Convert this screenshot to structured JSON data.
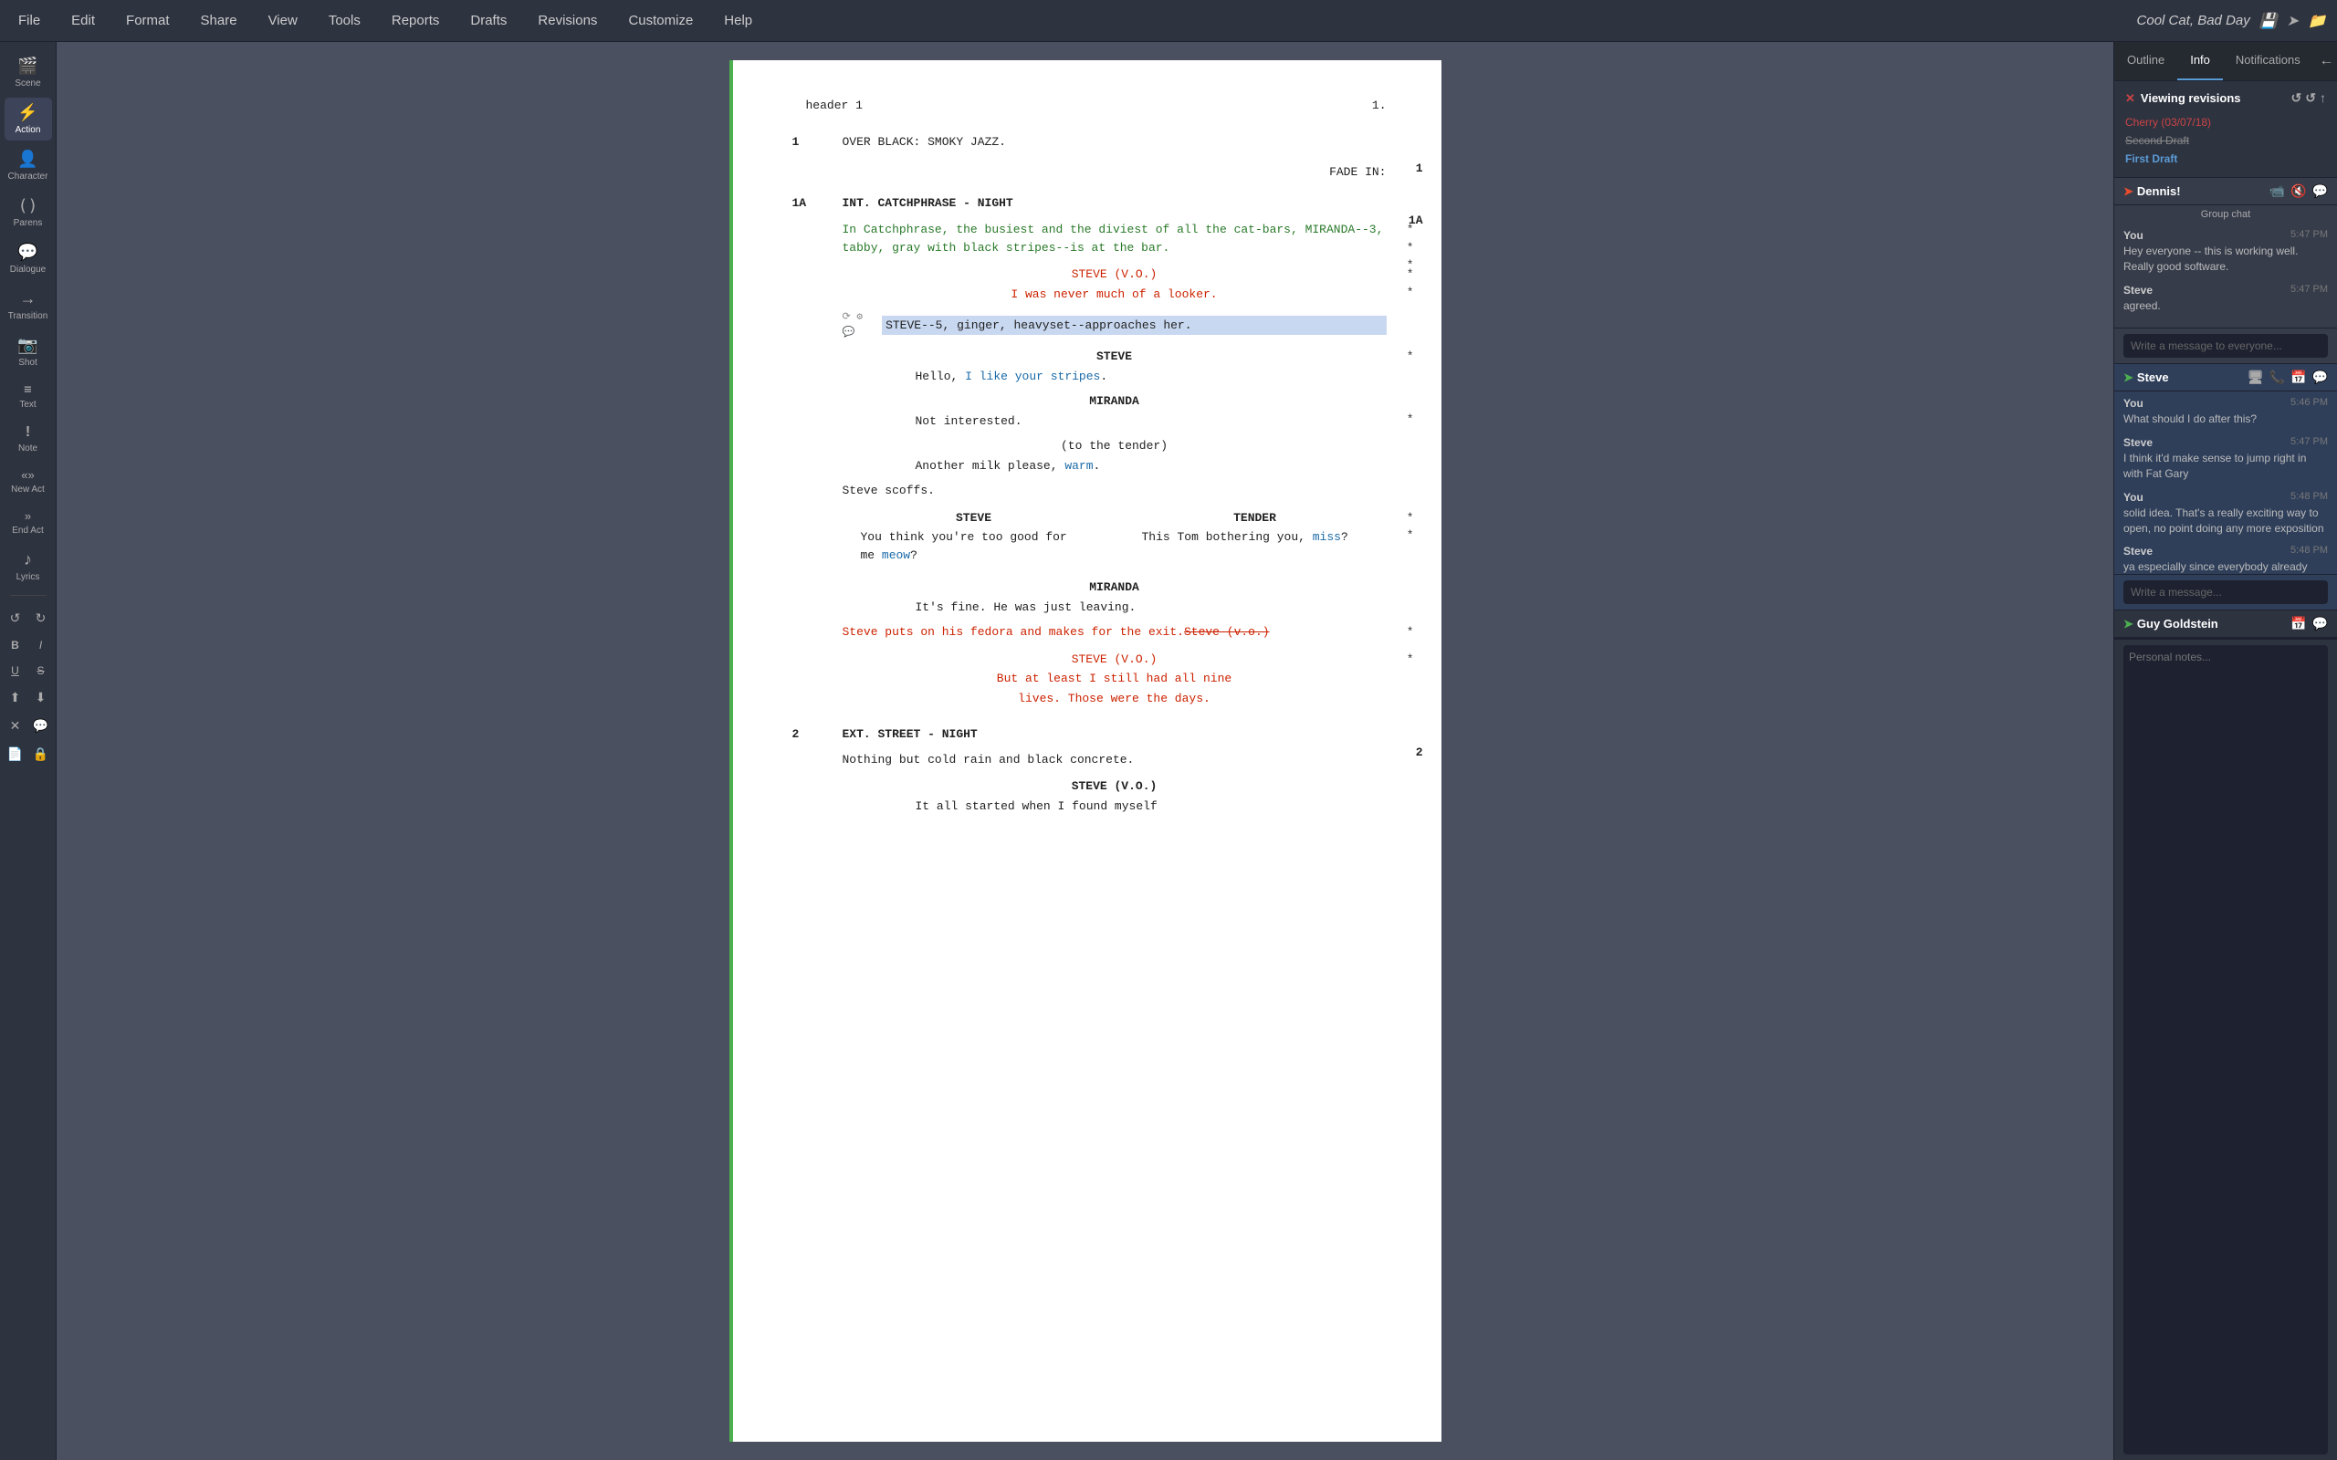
{
  "menu": {
    "items": [
      "File",
      "Edit",
      "Format",
      "Share",
      "View",
      "Tools",
      "Reports",
      "Drafts",
      "Revisions",
      "Customize",
      "Help"
    ]
  },
  "title": {
    "text": "Cool Cat, Bad Day",
    "icon_save": "💾",
    "icon_share": "➤",
    "icon_folder": "📁"
  },
  "sidebar": {
    "items": [
      {
        "icon": "🎬",
        "label": "Scene"
      },
      {
        "icon": "⚡",
        "label": "Action"
      },
      {
        "icon": "👤",
        "label": "Character"
      },
      {
        "icon": "()",
        "label": "Parens"
      },
      {
        "icon": "💬",
        "label": "Dialogue"
      },
      {
        "icon": "→",
        "label": "Transition"
      },
      {
        "icon": "📷",
        "label": "Shot"
      },
      {
        "icon": "≡",
        "label": "Text"
      },
      {
        "icon": "!",
        "label": "Note"
      },
      {
        "icon": "«»",
        "label": "New Act"
      },
      {
        "icon": "»",
        "label": "End Act"
      },
      {
        "icon": "♪",
        "label": "Lyrics"
      }
    ],
    "bottom_icons": [
      "↺",
      "↻",
      "B",
      "I",
      "U",
      "S",
      "⬆",
      "⬇",
      "✕",
      "💬",
      "📄",
      "🔒"
    ]
  },
  "script": {
    "header": {
      "left": "header 1",
      "right": "1."
    },
    "scene1": {
      "number": "1",
      "action": "OVER BLACK: SMOKY JAZZ.",
      "scene_number_right": "1"
    },
    "fade_in": "FADE IN:",
    "scene1a": {
      "number": "1A",
      "heading": "INT. CATCHPHRASE - NIGHT",
      "scene_number_right": "1A",
      "action_green": "In Catchphrase, the busiest and the diviest of all the cat-bars, MIRANDA--3, tabby, gray with black stripes--is at the bar.",
      "vo_char": "STEVE (V.O.)",
      "vo_line1": "I was never much of a looker.",
      "highlight_action": "STEVE--5, ginger, heavyset--approaches her.",
      "char1": "STEVE",
      "dia1": "Hello, I like your stripes.",
      "char2": "MIRANDA",
      "dia2a": "Not interested.",
      "paren2": "(to the tender)",
      "dia2b": "Another milk please, warm.",
      "action2": "Steve scoffs.",
      "dual_left": {
        "char": "STEVE",
        "dia": "You think you're too good for me meow?"
      },
      "dual_right": {
        "char": "TENDER",
        "dia": "This Tom bothering you, miss?"
      },
      "char3": "MIRANDA",
      "dia3": "It's fine. He was just leaving.",
      "red_action": "Steve puts on his fedora and makes for the exit.",
      "red_strike": "Steve (v.o.)",
      "vo_char2": "STEVE (V.O.)",
      "vo2_line1": "But at least I still had all nine",
      "vo2_line2": "lives. Those were the days."
    },
    "scene2": {
      "number": "2",
      "heading": "EXT. STREET - NIGHT",
      "scene_number_right": "2",
      "action3": "Nothing but cold rain and black concrete.",
      "char4": "STEVE (V.O.)",
      "dia4": "It all started when I found myself"
    }
  },
  "right_panel": {
    "tabs": [
      "Outline",
      "Info",
      "Notifications"
    ],
    "active_tab": "Info",
    "revisions_title": "Viewing revisions",
    "revision_items": [
      {
        "label": "Cherry (03/07/18)",
        "style": "cherry"
      },
      {
        "label": "Second Draft",
        "style": "second"
      },
      {
        "label": "First Draft",
        "style": "first"
      }
    ],
    "chats": [
      {
        "name": "Dennis!",
        "arrow_color": "red",
        "icons": [
          "📹",
          "🔇",
          "💬"
        ],
        "group_label": "Group chat",
        "messages": [
          {
            "sender": "You",
            "time": "5:47 PM",
            "text": "Hey everyone -- this is working well. Really good software."
          },
          {
            "sender": "Steve",
            "time": "5:47 PM",
            "text": "agreed."
          }
        ],
        "input_placeholder": "Write a message to everyone..."
      },
      {
        "name": "Steve",
        "arrow_color": "green",
        "icons": [
          "🖥",
          "📞",
          "📅",
          "💬"
        ],
        "messages": [
          {
            "sender": "You",
            "time": "5:46 PM",
            "text": "What should I do after this?"
          },
          {
            "sender": "Steve",
            "time": "5:47 PM",
            "text": "I think it'd make sense to jump right in with Fat Gary"
          },
          {
            "sender": "You",
            "time": "5:48 PM",
            "text": "solid idea. That's a really exciting way to open, no point doing any more exposition"
          },
          {
            "sender": "Steve",
            "time": "5:48 PM",
            "text": "ya especially since everybody already gets noir and knows what to expect right off the bat"
          }
        ],
        "input_placeholder": "Write a message..."
      },
      {
        "name": "Guy Goldstein",
        "arrow_color": "green",
        "icons": [
          "📅",
          "💬"
        ]
      }
    ],
    "personal_notes_placeholder": "Personal notes..."
  }
}
